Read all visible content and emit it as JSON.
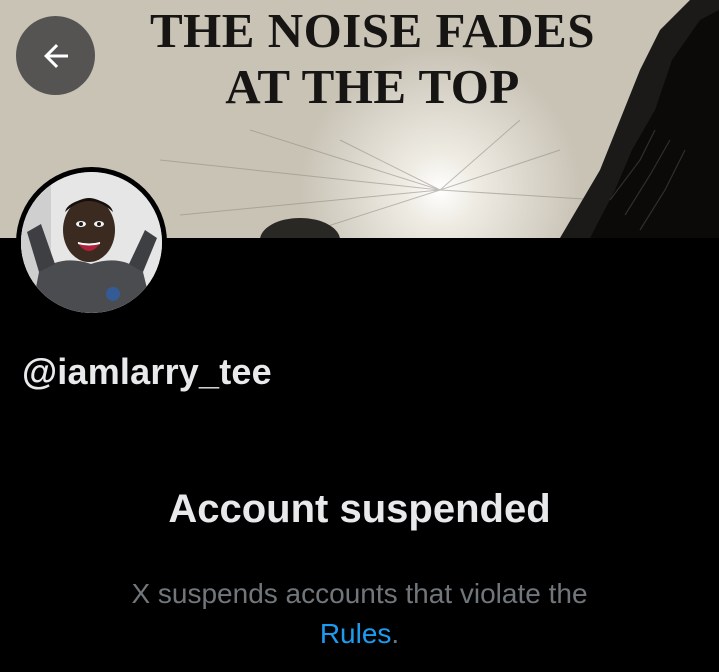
{
  "banner": {
    "title_line1": "THE NOISE FADES",
    "title_line2": "AT THE TOP"
  },
  "header": {
    "back_icon": "arrow-left-icon"
  },
  "profile": {
    "handle": "@iamlarry_tee",
    "avatar": "avatar-photo"
  },
  "notice": {
    "headline": "Account suspended",
    "message_prefix": "X suspends accounts that violate the",
    "link_text": "Rules",
    "message_suffix": "."
  },
  "colors": {
    "background": "#000000",
    "primary_text": "#e7e9ea",
    "secondary_text": "#71767b",
    "link": "#1d9bf0",
    "back_button_bg": "#4b4b4b"
  }
}
